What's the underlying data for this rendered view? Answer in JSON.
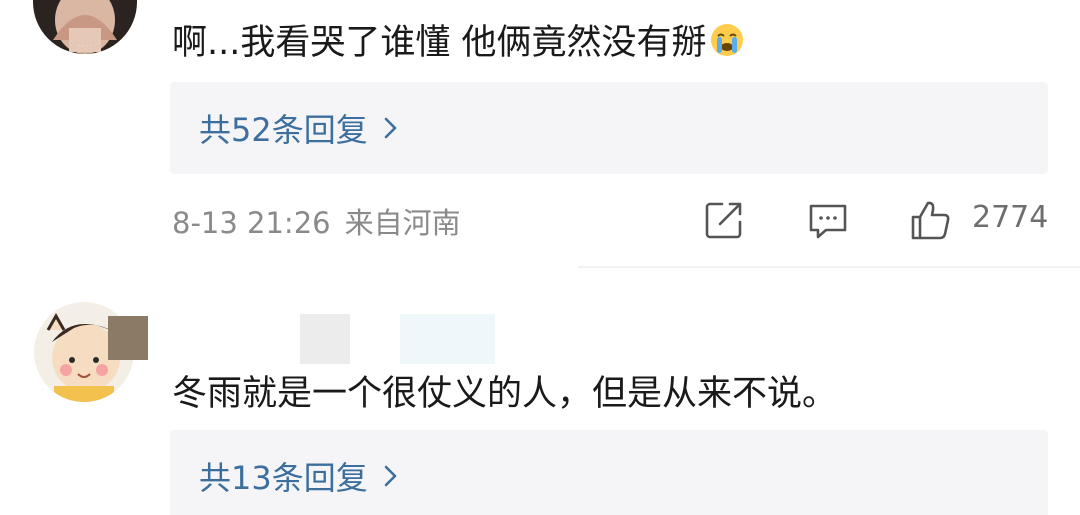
{
  "comments": [
    {
      "text": "啊...我看哭了谁懂 他俩竟然没有掰",
      "emoji_icon": "crying-face-emoji",
      "replies_label": "共52条回复",
      "date": "8-13 21:26",
      "location": "来自河南",
      "like_count": "2774"
    },
    {
      "text": "冬雨就是一个很仗义的人，但是从来不说。",
      "replies_label": "共13条回复"
    }
  ],
  "colors": {
    "link": "#3d6f9e",
    "meta": "#8a8a8a",
    "reply_bg": "#f5f5f7"
  },
  "icons": [
    "share-icon",
    "comment-icon",
    "like-icon",
    "chevron-right-icon"
  ]
}
